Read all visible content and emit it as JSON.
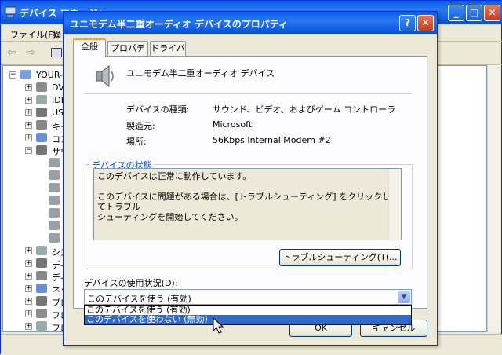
{
  "bg_window": {
    "title": "デバイス マネージャ",
    "menu": [
      "ファイル(F)",
      "操"
    ],
    "tree_root": "YOUR-",
    "tree_items": [
      "DV",
      "IDE",
      "US",
      "キー",
      "コン",
      "サウ",
      "",
      "",
      "",
      "",
      "",
      "",
      "",
      "シス",
      "ディ",
      "ディ",
      "ネッ",
      "プロ",
      "フロ",
      "フロ"
    ]
  },
  "dialog": {
    "title": "ユニモデム半二重オーディオ デバイスのプロパティ",
    "help_glyph": "?",
    "close_glyph": "✕",
    "tabs": [
      "全般",
      "プロパティ",
      "ドライバ"
    ],
    "device_name": "ユニモデム半二重オーディオ デバイス",
    "fields": [
      {
        "label": "デバイスの種類:",
        "value": "サウンド、ビデオ、およびゲーム コントローラ"
      },
      {
        "label": "製造元:",
        "value": "Microsoft"
      },
      {
        "label": "場所:",
        "value": "56Kbps Internal Modem #2"
      }
    ],
    "status_group_title": "デバイスの状態",
    "status_line1": "このデバイスは正常に動作しています。",
    "status_line2": "このデバイスに問題がある場合は、[トラブルシューティング] をクリックしてトラブル",
    "status_line3": "シューティングを開始してください。",
    "troubleshoot_button": "トラブルシューティング(T)...",
    "usage_label": "デバイスの使用状況(D):",
    "usage_value": "このデバイスを使う (有効)",
    "usage_options": [
      "このデバイスを使う (有効)",
      "このデバイスを使わない (無効)"
    ],
    "ok_button": "OK",
    "cancel_button": "キャンセル"
  }
}
